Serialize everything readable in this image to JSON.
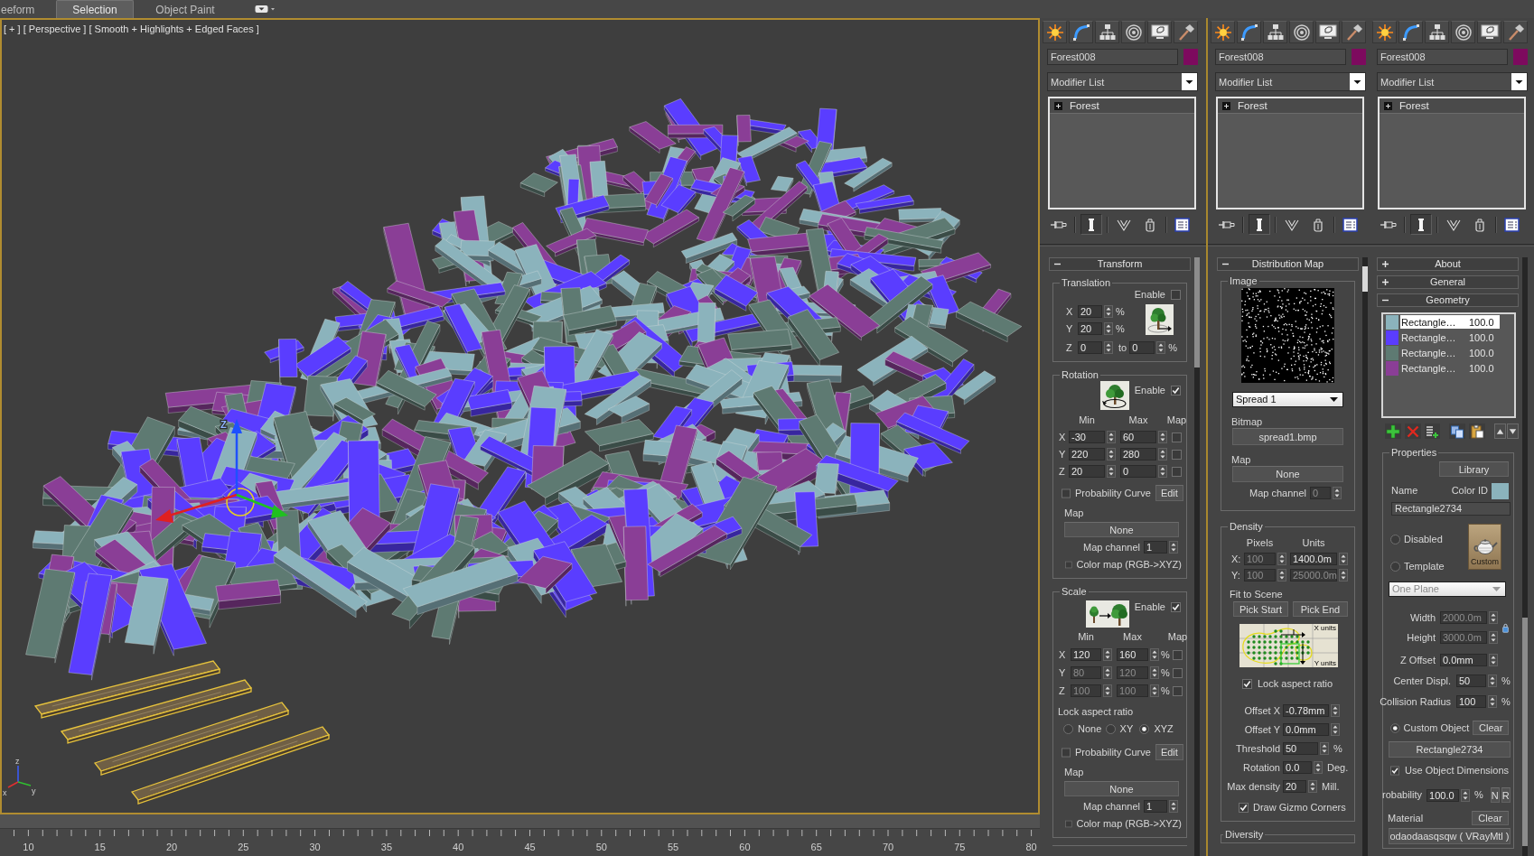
{
  "ribbon": {
    "tabs": [
      {
        "label": "eeform",
        "selected": false
      },
      {
        "label": "Selection",
        "selected": true
      },
      {
        "label": "Object Paint",
        "selected": false
      }
    ]
  },
  "viewport": {
    "label": "[ + ] [ Perspective ] [ Smooth + Highlights + Edged Faces ]",
    "gizmo_label": "Z",
    "axis_labels": [
      "z",
      "x",
      "y"
    ]
  },
  "timeline": {
    "labels": [
      "10",
      "15",
      "20",
      "25",
      "30",
      "35",
      "40",
      "45",
      "50",
      "55",
      "60",
      "65",
      "70",
      "75",
      "80"
    ]
  },
  "panels": [
    {
      "object": {
        "name": "Forest008",
        "color": "#7d0a5e"
      },
      "modifier_list": "Modifier List",
      "stack": [
        {
          "label": "Forest",
          "expanded": false
        }
      ],
      "stack_tools": [
        {
          "pressed": false
        },
        {
          "pressed": true
        },
        {
          "pressed": false
        },
        {
          "pressed": false
        },
        {
          "pressed": false
        }
      ],
      "rollouts": [
        {
          "kind": "transform",
          "title": "Transform",
          "expanded": true,
          "translation": {
            "title": "Translation",
            "enable": {
              "label": "Enable",
              "checked": false
            },
            "x": {
              "label": "X",
              "value": "20",
              "disabled": false,
              "unit": "%"
            },
            "y": {
              "label": "Y",
              "value": "20",
              "disabled": false,
              "unit": "%"
            },
            "z": {
              "label": "Z",
              "from": {
                "value": "0",
                "disabled": false
              },
              "to_label": "to",
              "to": {
                "value": "0",
                "disabled": false
              },
              "unit": "%"
            }
          },
          "rotation": {
            "title": "Rotation",
            "enable": {
              "label": "Enable",
              "checked": true
            },
            "headers": [
              "Min",
              "Max",
              "Map"
            ],
            "rows": [
              {
                "axis": "X",
                "min": {
                  "value": "-30",
                  "disabled": false
                },
                "max": {
                  "value": "60",
                  "disabled": false
                },
                "map": {
                  "checked": false
                }
              },
              {
                "axis": "Y",
                "min": {
                  "value": "220",
                  "disabled": false
                },
                "max": {
                  "value": "280",
                  "disabled": false
                },
                "map": {
                  "checked": false
                }
              },
              {
                "axis": "Z",
                "min": {
                  "value": "20",
                  "disabled": false
                },
                "max": {
                  "value": "0",
                  "disabled": false
                },
                "map": {
                  "checked": false
                }
              }
            ],
            "probability_curve": {
              "label": "Probability Curve",
              "checked": false
            },
            "edit_button": "Edit",
            "map_label": "Map",
            "map_button": "None",
            "map_channel": {
              "label": "Map channel",
              "value": "1",
              "disabled": false
            },
            "color_map": {
              "label": "Color map (RGB->XYZ)",
              "checked": false
            }
          },
          "scale": {
            "title": "Scale",
            "enable": {
              "label": "Enable",
              "checked": true
            },
            "headers": [
              "Min",
              "Max",
              "Map"
            ],
            "rows": [
              {
                "axis": "X",
                "min": {
                  "value": "120",
                  "disabled": false
                },
                "max": {
                  "value": "160",
                  "disabled": false
                },
                "unit": "%",
                "map": {
                  "checked": false
                }
              },
              {
                "axis": "Y",
                "min": {
                  "value": "80",
                  "disabled": true
                },
                "max": {
                  "value": "120",
                  "disabled": true
                },
                "unit": "%",
                "map": {
                  "checked": false
                }
              },
              {
                "axis": "Z",
                "min": {
                  "value": "100",
                  "disabled": true
                },
                "max": {
                  "value": "100",
                  "disabled": true
                },
                "unit": "%",
                "map": {
                  "checked": false
                }
              }
            ],
            "lock": {
              "label": "Lock aspect ratio",
              "options": [
                {
                  "label": "None",
                  "selected": false
                },
                {
                  "label": "XY",
                  "selected": false
                },
                {
                  "label": "XYZ",
                  "selected": true
                }
              ]
            },
            "probability_curve": {
              "label": "Probability Curve",
              "checked": false
            },
            "edit_button": "Edit",
            "map_label": "Map",
            "map_button": "None",
            "map_channel": {
              "label": "Map channel",
              "value": "1",
              "disabled": false
            },
            "color_map": {
              "label": "Color map (RGB->XYZ)",
              "checked": false
            }
          }
        }
      ]
    },
    {
      "object": {
        "name": "Forest008",
        "color": "#7d0a5e"
      },
      "modifier_list": "Modifier List",
      "stack": [
        {
          "label": "Forest",
          "expanded": false
        }
      ],
      "stack_tools": [
        {
          "pressed": false
        },
        {
          "pressed": true
        },
        {
          "pressed": false
        },
        {
          "pressed": false
        },
        {
          "pressed": false
        }
      ],
      "rollouts": [
        {
          "kind": "distribution",
          "title": "Distribution Map",
          "expanded": true,
          "image": {
            "title": "Image",
            "preset": "Spread 1",
            "bitmap_label": "Bitmap",
            "bitmap_button": "spread1.bmp",
            "map_label": "Map",
            "map_button": "None",
            "map_channel": {
              "label": "Map channel",
              "value": "0",
              "disabled": true
            }
          },
          "density": {
            "title": "Density",
            "headers": [
              "Pixels",
              "Units"
            ],
            "rows": [
              {
                "axis": "X:",
                "pixels": {
                  "value": "100",
                  "disabled": true
                },
                "units": {
                  "value": "1400.0m",
                  "disabled": false
                }
              },
              {
                "axis": "Y:",
                "pixels": {
                  "value": "100",
                  "disabled": true
                },
                "units": {
                  "value": "25000.0m",
                  "disabled": true
                }
              }
            ],
            "fit_label": "Fit to Scene",
            "pick_buttons": [
              "Pick Start",
              "Pick End"
            ],
            "diagram_labels": [
              "X units",
              "Y units"
            ],
            "lock": {
              "label": "Lock aspect ratio",
              "checked": true
            },
            "fields": [
              {
                "label": "Offset X",
                "value": "-0.78mm",
                "disabled": false
              },
              {
                "label": "Offset Y",
                "value": "0.0mm",
                "disabled": false
              },
              {
                "label": "Threshold",
                "value": "50",
                "disabled": false,
                "unit": "%"
              },
              {
                "label": "Rotation",
                "value": "0.0",
                "disabled": false,
                "unit": "Deg."
              },
              {
                "label": "Max density",
                "value": "20",
                "disabled": false,
                "unit": "Mill."
              }
            ],
            "gizmo_corners": {
              "label": "Draw Gizmo Corners",
              "checked": true
            }
          },
          "diversity": {
            "title": "Diversity"
          }
        }
      ]
    },
    {
      "object": {
        "name": "Forest008",
        "color": "#7d0a5e"
      },
      "modifier_list": "Modifier List",
      "stack": [
        {
          "label": "Forest",
          "expanded": false
        }
      ],
      "stack_tools": [
        {
          "pressed": false
        },
        {
          "pressed": true
        },
        {
          "pressed": false
        },
        {
          "pressed": false
        },
        {
          "pressed": false
        }
      ],
      "rollouts": [
        {
          "kind": "plain",
          "title": "About",
          "expanded": false
        },
        {
          "kind": "plain",
          "title": "General",
          "expanded": false
        },
        {
          "kind": "geometry",
          "title": "Geometry",
          "expanded": true,
          "items": [
            {
              "name": "Rectangle…",
              "value": "100.0",
              "color": "#8bb3bc",
              "selected": true
            },
            {
              "name": "Rectangle…",
              "value": "100.0",
              "color": "#5a3dff",
              "selected": false
            },
            {
              "name": "Rectangle…",
              "value": "100.0",
              "color": "#5e7a72",
              "selected": false
            },
            {
              "name": "Rectangle…",
              "value": "100.0",
              "color": "#8a3e96",
              "selected": false
            }
          ],
          "properties": {
            "title": "Properties",
            "library_button": "Library",
            "name_label": "Name",
            "color_id": {
              "label": "Color ID",
              "color": "#8bb3bc"
            },
            "name_value": "Rectangle2734",
            "modes": [
              {
                "label": "Disabled",
                "selected": false
              },
              {
                "label": "Template",
                "selected": false
              }
            ],
            "thumbnail_label": "Custom",
            "template": {
              "value": "One Plane",
              "disabled": true
            },
            "size": [
              {
                "label": "Width",
                "value": "2000.0m",
                "disabled": true
              },
              {
                "label": "Height",
                "value": "3000.0m",
                "disabled": true
              }
            ],
            "fields": [
              {
                "label": "Z Offset",
                "value": "0.0mm",
                "disabled": false
              },
              {
                "label": "Center Displ.",
                "value": "50",
                "disabled": false,
                "unit": "%"
              },
              {
                "label": "Collision Radius",
                "value": "100",
                "disabled": false,
                "unit": "%"
              }
            ],
            "custom_object": {
              "label": "Custom Object",
              "selected": true,
              "clear_button": "Clear",
              "object_button": "Rectangle2734"
            },
            "use_dimensions": {
              "label": "Use Object Dimensions",
              "checked": true
            },
            "probability": {
              "label": "robability",
              "value": "100.0",
              "disabled": false,
              "unit": "%",
              "buttons": [
                "N",
                "R"
              ]
            },
            "material": {
              "label": "Material",
              "clear_button": "Clear",
              "value": "odaodaasqsqw ( VRayMtl )"
            }
          }
        }
      ]
    }
  ]
}
